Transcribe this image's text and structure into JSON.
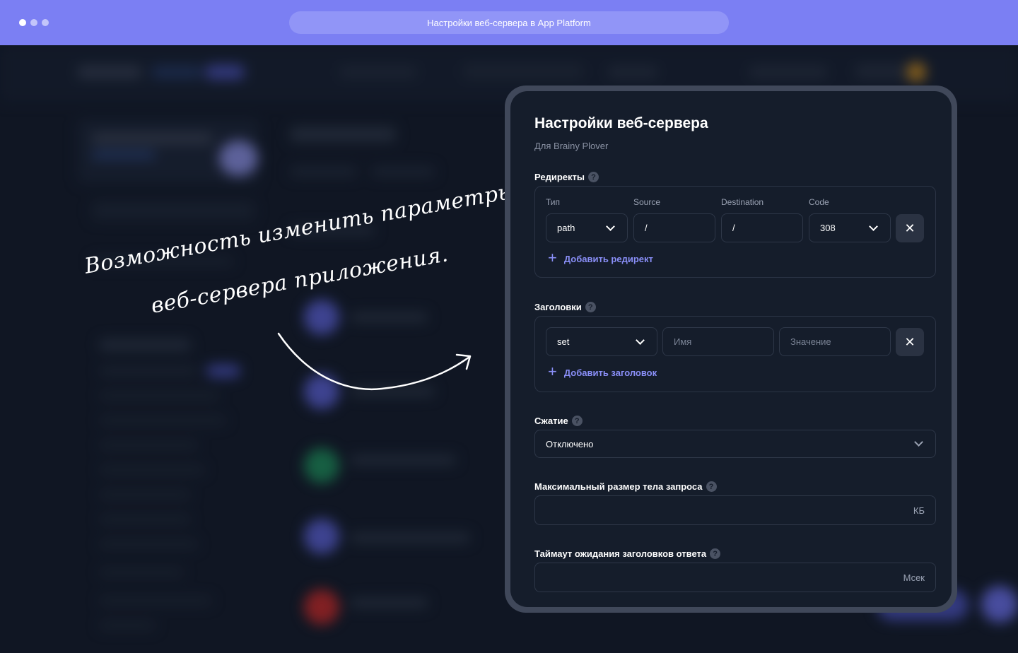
{
  "window": {
    "title": "Настройки веб-сервера в App Platform"
  },
  "annotation": {
    "line1": "Возможность изменить параметры",
    "line2": "веб-сервера приложения."
  },
  "modal": {
    "title": "Настройки веб-сервера",
    "subtitle": "Для Brainy Plover",
    "redirects": {
      "label": "Редиректы",
      "columns": [
        "Тип",
        "Source",
        "Destination",
        "Code"
      ],
      "row": {
        "type": "path",
        "source": "/",
        "destination": "/",
        "code": "308"
      },
      "add_label": "Добавить редирект"
    },
    "headers": {
      "label": "Заголовки",
      "row": {
        "action": "set",
        "name_placeholder": "Имя",
        "value_placeholder": "Значение"
      },
      "add_label": "Добавить заголовок"
    },
    "compression": {
      "label": "Сжатие",
      "value": "Отключено"
    },
    "max_body": {
      "label": "Максимальный размер тела запроса",
      "value": "",
      "unit": "КБ"
    },
    "header_timeout": {
      "label": "Таймаут ожидания заголовков ответа",
      "value": "",
      "unit": "Мсек"
    }
  }
}
